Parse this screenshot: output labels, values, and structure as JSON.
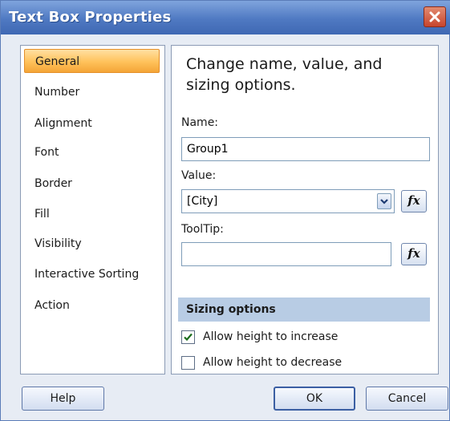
{
  "window": {
    "title": "Text Box Properties"
  },
  "sidebar": {
    "items": [
      {
        "label": "General",
        "selected": true
      },
      {
        "label": "Number"
      },
      {
        "label": "Alignment"
      },
      {
        "label": "Font"
      },
      {
        "label": "Border"
      },
      {
        "label": "Fill"
      },
      {
        "label": "Visibility"
      },
      {
        "label": "Interactive Sorting"
      },
      {
        "label": "Action"
      }
    ]
  },
  "main": {
    "heading": "Change name, value, and sizing options.",
    "name_label": "Name:",
    "name_value": "Group1",
    "value_label": "Value:",
    "value_selected": "[City]",
    "tooltip_label": "ToolTip:",
    "tooltip_value": "",
    "fx_label": "fx",
    "sizing_header": "Sizing options",
    "allow_increase_label": "Allow height to increase",
    "allow_increase_checked": true,
    "allow_decrease_label": "Allow height to decrease",
    "allow_decrease_checked": false
  },
  "footer": {
    "help_label": "Help",
    "ok_label": "OK",
    "cancel_label": "Cancel"
  },
  "colors": {
    "title_bar": "#4f79c2",
    "selected_item": "#ffc15a",
    "section_header": "#b8cce4",
    "close_button": "#c8452d"
  }
}
